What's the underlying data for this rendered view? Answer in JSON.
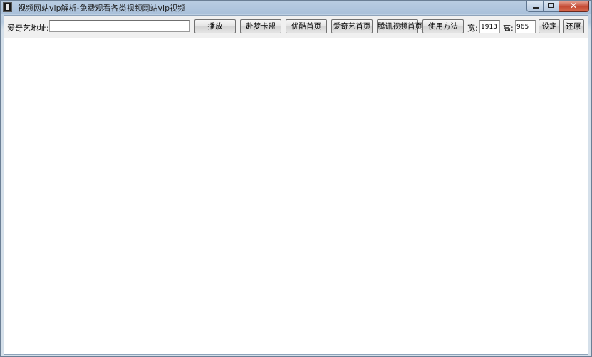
{
  "window": {
    "title": "视频网站vip解析-免费观看各类视频网站vip视频"
  },
  "toolbar": {
    "url_label": "爱奇艺地址:",
    "url_value": "",
    "buttons": {
      "play": "播放",
      "fumeng": "赴梦卡盟",
      "youku": "优酷首页",
      "iqiyi": "爱奇艺首页",
      "tencent": "腾讯视频首页",
      "help": "使用方法",
      "set": "设定",
      "restore": "还原"
    },
    "width_label": "宽:",
    "width_value": "1913",
    "height_label": "高:",
    "height_value": "965"
  },
  "colors": {
    "title_bar": "#b9cde2",
    "close_button": "#c44b34",
    "toolbar_bg": "#f0f0f0",
    "content_bg": "#ffffff"
  },
  "icons": {
    "app": "app-icon",
    "minimize": "minimize-icon",
    "maximize": "maximize-icon",
    "close": "close-icon"
  }
}
